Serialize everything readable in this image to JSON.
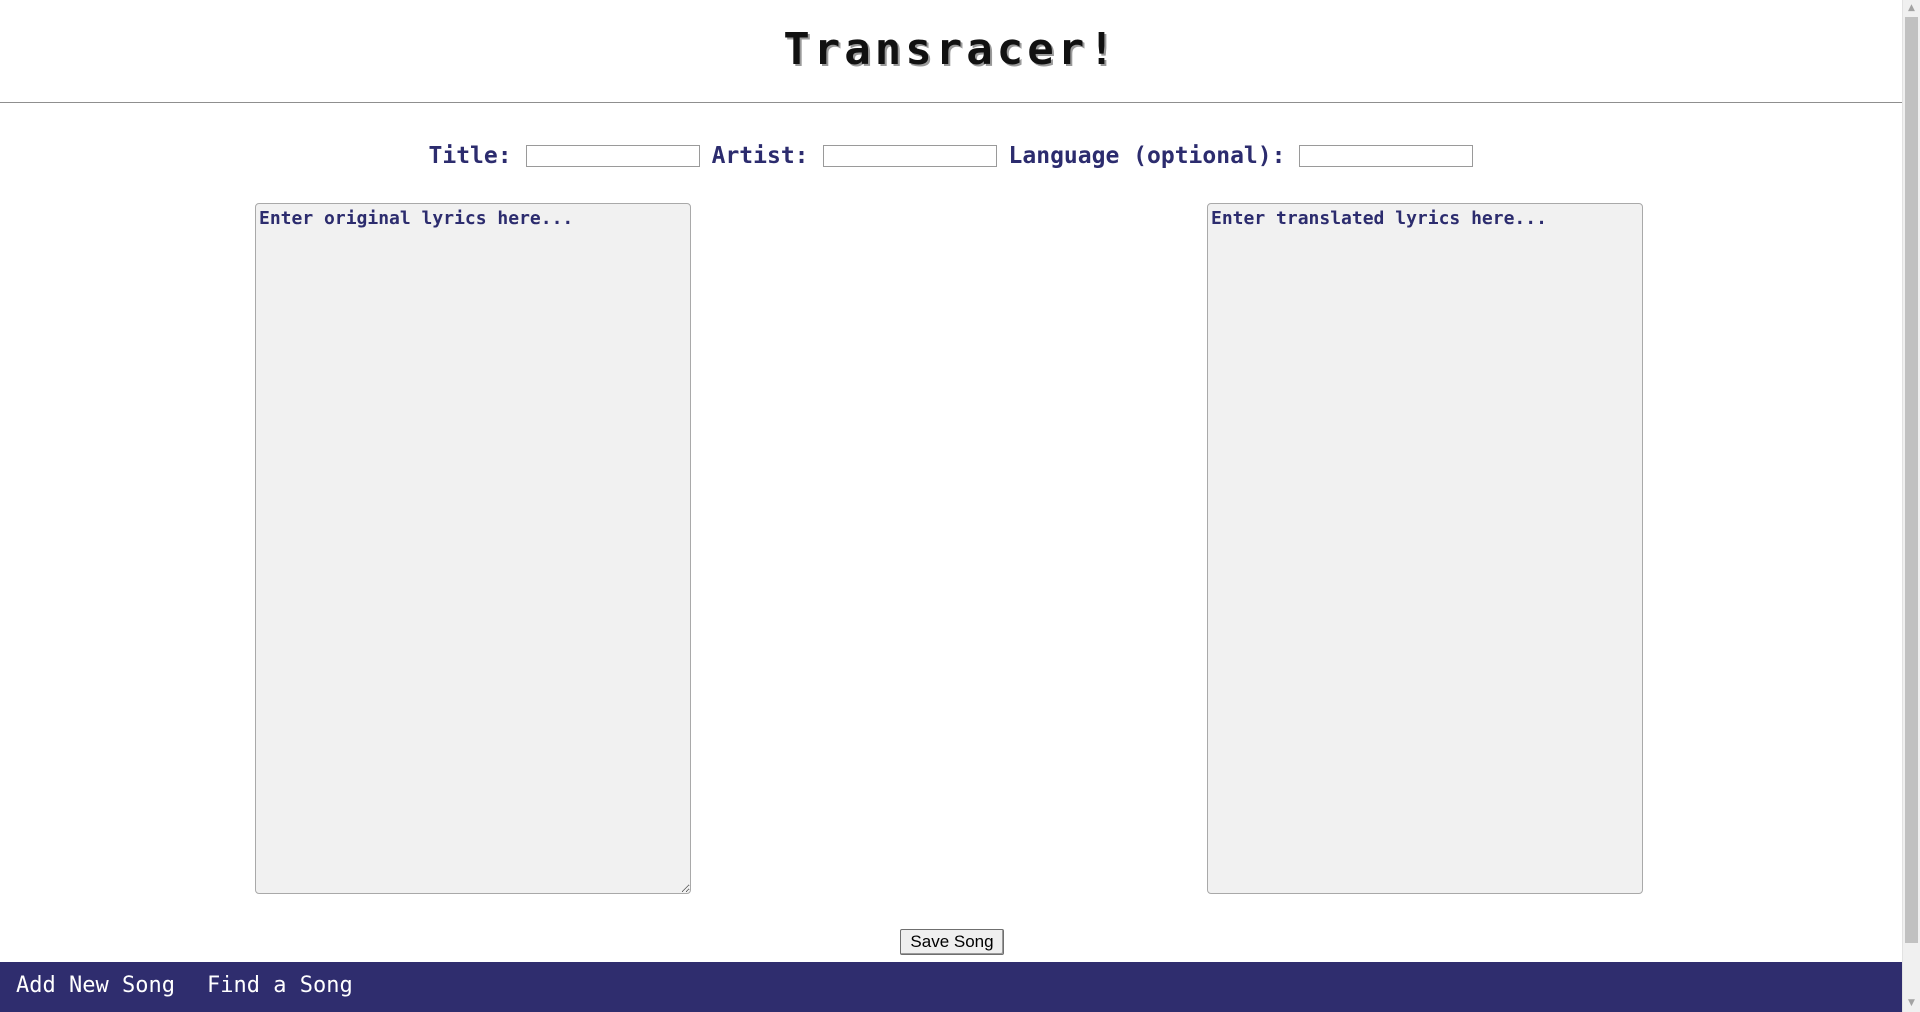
{
  "header": {
    "title": "Transracer!"
  },
  "form": {
    "title_label": "Title:",
    "title_value": "",
    "artist_label": "Artist:",
    "artist_value": "",
    "language_label": "Language (optional):",
    "language_value": "",
    "original_placeholder": "Enter original lyrics here...",
    "original_value": "",
    "translated_placeholder": "Enter translated lyrics here...",
    "translated_value": "",
    "save_label": "Save Song"
  },
  "nav": {
    "items": [
      {
        "label": "Add New Song"
      },
      {
        "label": "Find a Song"
      }
    ]
  },
  "scrollbar": {
    "up_icon": "scroll-up-arrow-icon",
    "down_icon": "scroll-down-arrow-icon",
    "position": 0
  },
  "colors": {
    "label_text": "#2c2c6e",
    "nav_background": "#2f2d6e",
    "nav_text": "#ffffff",
    "textarea_background": "#f1f1f1",
    "title_shadow": "#9a9a9a"
  }
}
